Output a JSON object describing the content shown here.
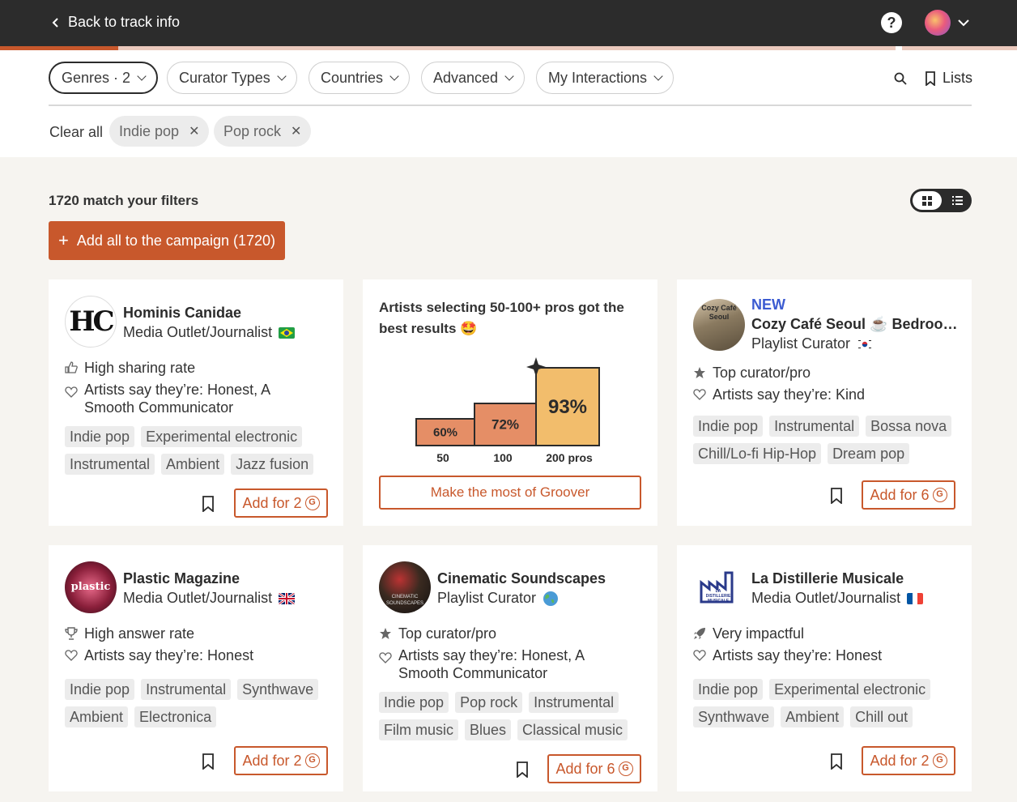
{
  "topbar": {
    "back_label": "Back to track info",
    "help_glyph": "?"
  },
  "progress_fraction": 0.116,
  "filters": {
    "genres": "Genres · 2",
    "curator_types": "Curator Types",
    "countries": "Countries",
    "advanced": "Advanced",
    "my_interactions": "My Interactions",
    "lists": "Lists",
    "clear_all": "Clear all",
    "chips": [
      "Indie pop",
      "Pop rock"
    ]
  },
  "results": {
    "count_text": "1720 match your filters",
    "add_all_label": "Add all to the campaign (1720)"
  },
  "colors": {
    "accent": "#c8582c",
    "new_tag": "#3b5bd1",
    "dark": "#2c2c2c"
  },
  "cards": [
    {
      "name": "Hominis Canidae",
      "type": "Media Outlet/Journalist",
      "country_flag": "brazil-flag",
      "stats": [
        "High sharing rate",
        "Artists say they’re: Honest, A Smooth Communicator"
      ],
      "tags": [
        "Indie pop",
        "Experimental electronic",
        "Instrumental",
        "Ambient",
        "Jazz fusion"
      ],
      "add_label": "Add for 2",
      "avatar_text": "HC"
    },
    {
      "name": "Cozy Café Seoul ☕ Bedroo…",
      "new_label": "NEW",
      "type": "Playlist Curator",
      "country_flag": "south-korea-flag",
      "stats": [
        "Top curator/pro",
        "Artists say they’re: Kind"
      ],
      "tags": [
        "Indie pop",
        "Instrumental",
        "Bossa nova",
        "Chill/Lo-fi Hip-Hop",
        "Dream pop"
      ],
      "add_label": "Add for 6",
      "avatar_text": "Cozy Café Seoul"
    },
    {
      "name": "Plastic Magazine",
      "type": "Media Outlet/Journalist",
      "country_flag": "uk-flag",
      "stats": [
        "High answer rate",
        "Artists say they’re: Honest"
      ],
      "tags": [
        "Indie pop",
        "Instrumental",
        "Synthwave",
        "Ambient",
        "Electronica"
      ],
      "add_label": "Add for 2",
      "avatar_text": "plastic"
    },
    {
      "name": "Cinematic Soundscapes",
      "type": "Playlist Curator",
      "country_flag": "globe-icon",
      "stats": [
        "Top curator/pro",
        "Artists say they’re: Honest, A Smooth Communicator"
      ],
      "tags": [
        "Indie pop",
        "Pop rock",
        "Instrumental",
        "Film music",
        "Blues",
        "Classical music"
      ],
      "add_label": "Add for 6",
      "avatar_text": "CINEMATIC SOUNDSCAPES"
    },
    {
      "name": "La Distillerie Musicale",
      "type": "Media Outlet/Journalist",
      "country_flag": "france-flag",
      "stats": [
        "Very impactful",
        "Artists say they’re: Honest"
      ],
      "tags": [
        "Indie pop",
        "Experimental electronic",
        "Synthwave",
        "Ambient",
        "Chill out"
      ],
      "add_label": "Add for 2",
      "avatar_text": "LA DISTILLERIE MUSICALE"
    }
  ],
  "promo": {
    "title": "Artists selecting 50-100+ pros got the best results 🤩",
    "button": "Make the most of Groover",
    "bars": [
      {
        "label": "50",
        "value": "60%",
        "pct": 60
      },
      {
        "label": "100",
        "value": "72%",
        "pct": 72
      },
      {
        "label": "200 pros",
        "value": "93%",
        "pct": 93
      }
    ]
  }
}
